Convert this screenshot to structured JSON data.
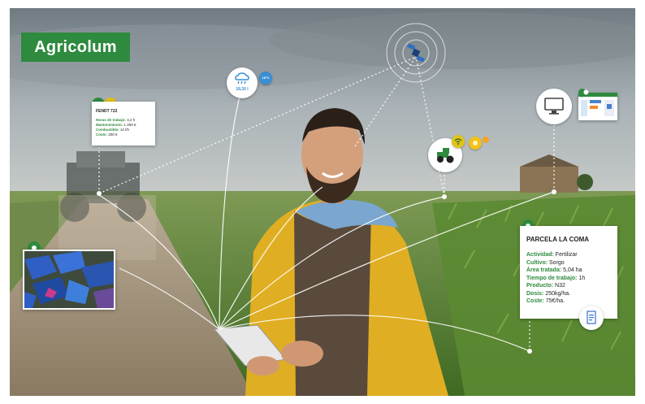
{
  "brand": {
    "label": "Agricolum",
    "color": "#2e8a3e"
  },
  "weather": {
    "icon": "rain-cloud-icon",
    "value": "18,30 l",
    "badge": "18°C"
  },
  "satellite": {
    "icon": "satellite-icon"
  },
  "tractor_bubble": {
    "icon": "tractor-icon"
  },
  "monitor_bubble": {
    "icon": "monitor-icon"
  },
  "machine_card": {
    "title": "FENDT 722",
    "rows": [
      {
        "key": "Horas de trabajo:",
        "value": "4,2 h"
      },
      {
        "key": "Mantenimiento:",
        "value": "1.250 €"
      },
      {
        "key": "Combustible:",
        "value": "12 l/h"
      },
      {
        "key": "Coste:",
        "value": "200 €"
      }
    ]
  },
  "parcel_card": {
    "title": "PARCELA LA COMA",
    "rows": [
      {
        "key": "Actividad:",
        "value": "Fertilizar"
      },
      {
        "key": "Cultivo:",
        "value": "Sorgo"
      },
      {
        "key": "Área tratada:",
        "value": "5,04 ha"
      },
      {
        "key": "Tiempo de trabajo:",
        "value": "1h"
      },
      {
        "key": "Producto:",
        "value": "N32"
      },
      {
        "key": "Dosis:",
        "value": "250kg/ha."
      },
      {
        "key": "Coste:",
        "value": "75€/ha."
      }
    ]
  }
}
